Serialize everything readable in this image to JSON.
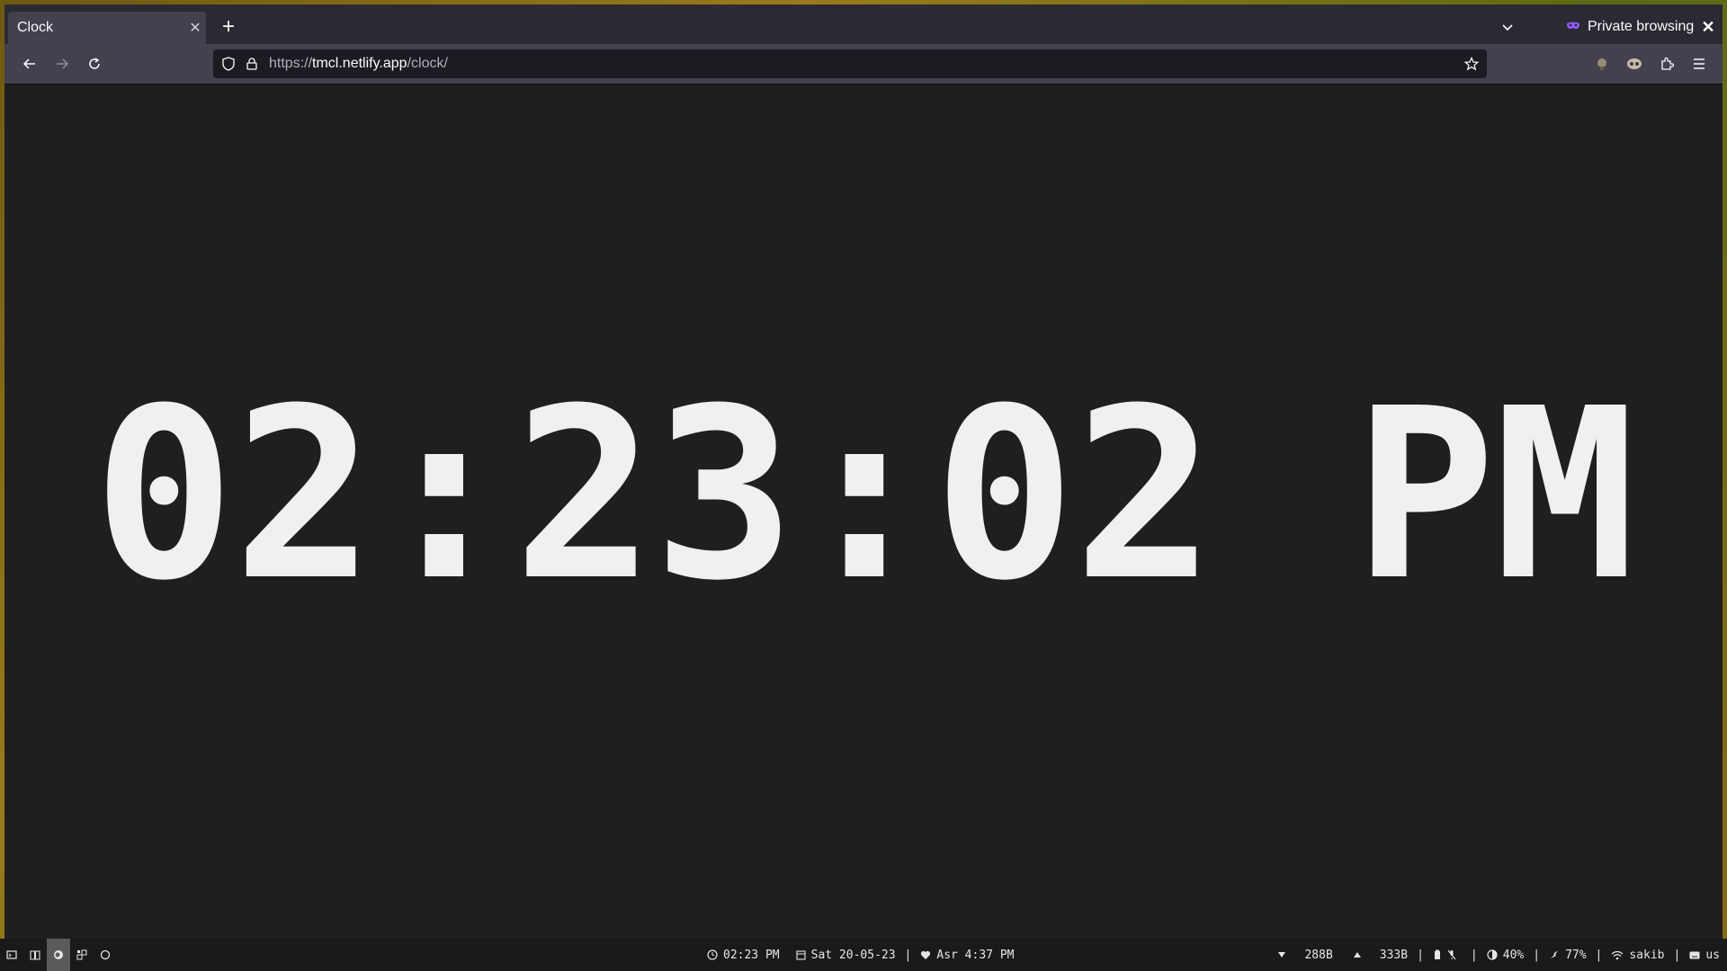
{
  "browser": {
    "tab_title": "Clock",
    "private_label": "Private browsing",
    "url_prefix": "https://",
    "url_host": "tmcl.netlify.app",
    "url_path": "/clock/"
  },
  "page": {
    "clock_text": "02:23:02 PM"
  },
  "taskbar": {
    "time": "02:23 PM",
    "date": "Sat 20-05-23",
    "prayer": "Asr 4:37 PM",
    "net_down": "288B",
    "net_up": "333B",
    "brightness": "40%",
    "battery": "77%",
    "wifi": "sakib",
    "keyboard": "us"
  },
  "colors": {
    "page_bg": "#1f1f1f",
    "clock_text": "#f0f0f0",
    "private_accent": "#9059ff"
  }
}
